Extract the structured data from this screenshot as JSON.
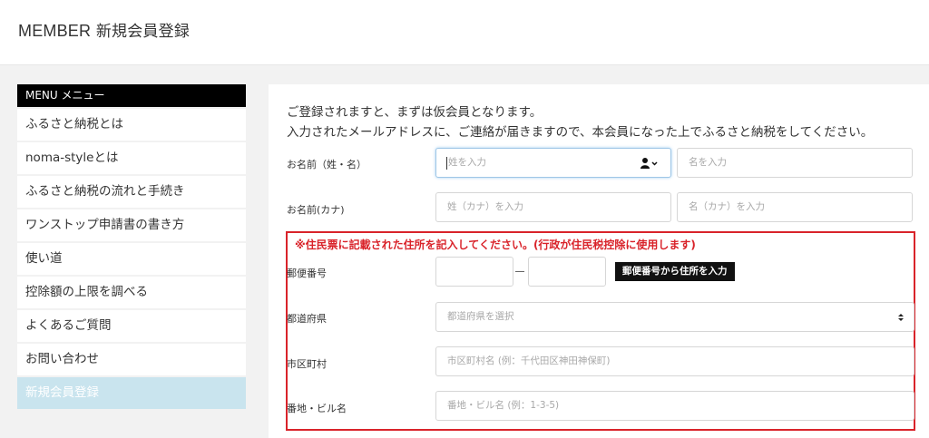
{
  "header": {
    "title_en": "MEMBER",
    "title_jp": "新規会員登録"
  },
  "sidebar": {
    "heading": "MENU メニュー",
    "items": [
      {
        "label": "ふるさと納税とは"
      },
      {
        "label": "noma-styleとは"
      },
      {
        "label": "ふるさと納税の流れと手続き"
      },
      {
        "label": "ワンストップ申請書の書き方"
      },
      {
        "label": "使い道"
      },
      {
        "label": "控除額の上限を調べる"
      },
      {
        "label": "よくあるご質問"
      },
      {
        "label": "お問い合わせ"
      },
      {
        "label": "新規会員登録"
      }
    ]
  },
  "main": {
    "intro_line1": "ご登録されますと、まずは仮会員となります。",
    "intro_line2": "入力されたメールアドレスに、ご連絡が届きますので、本会員になった上でふるさと納税をしてください。",
    "name": {
      "label": "お名前（姓・名）",
      "last_placeholder": "姓を入力",
      "first_placeholder": "名を入力"
    },
    "kana": {
      "label": "お名前(カナ)",
      "last_placeholder": "姓（カナ）を入力",
      "first_placeholder": "名（カナ）を入力"
    },
    "notice": "※住民票に記載された住所を記入してください。(行政が住民税控除に使用します)",
    "postal": {
      "label": "郵便番号",
      "button": "郵便番号から住所を入力"
    },
    "prefecture": {
      "label": "都道府県",
      "placeholder": "都道府県を選択"
    },
    "city": {
      "label": "市区町村",
      "placeholder": "市区町村名 (例：千代田区神田神保町)"
    },
    "address": {
      "label": "番地・ビル名",
      "placeholder": "番地・ビル名 (例：1-3-5)"
    }
  },
  "colors": {
    "accent_red": "#d9232a",
    "active_menu": "#c9e4ee",
    "focus_border": "#9ec6e6"
  }
}
